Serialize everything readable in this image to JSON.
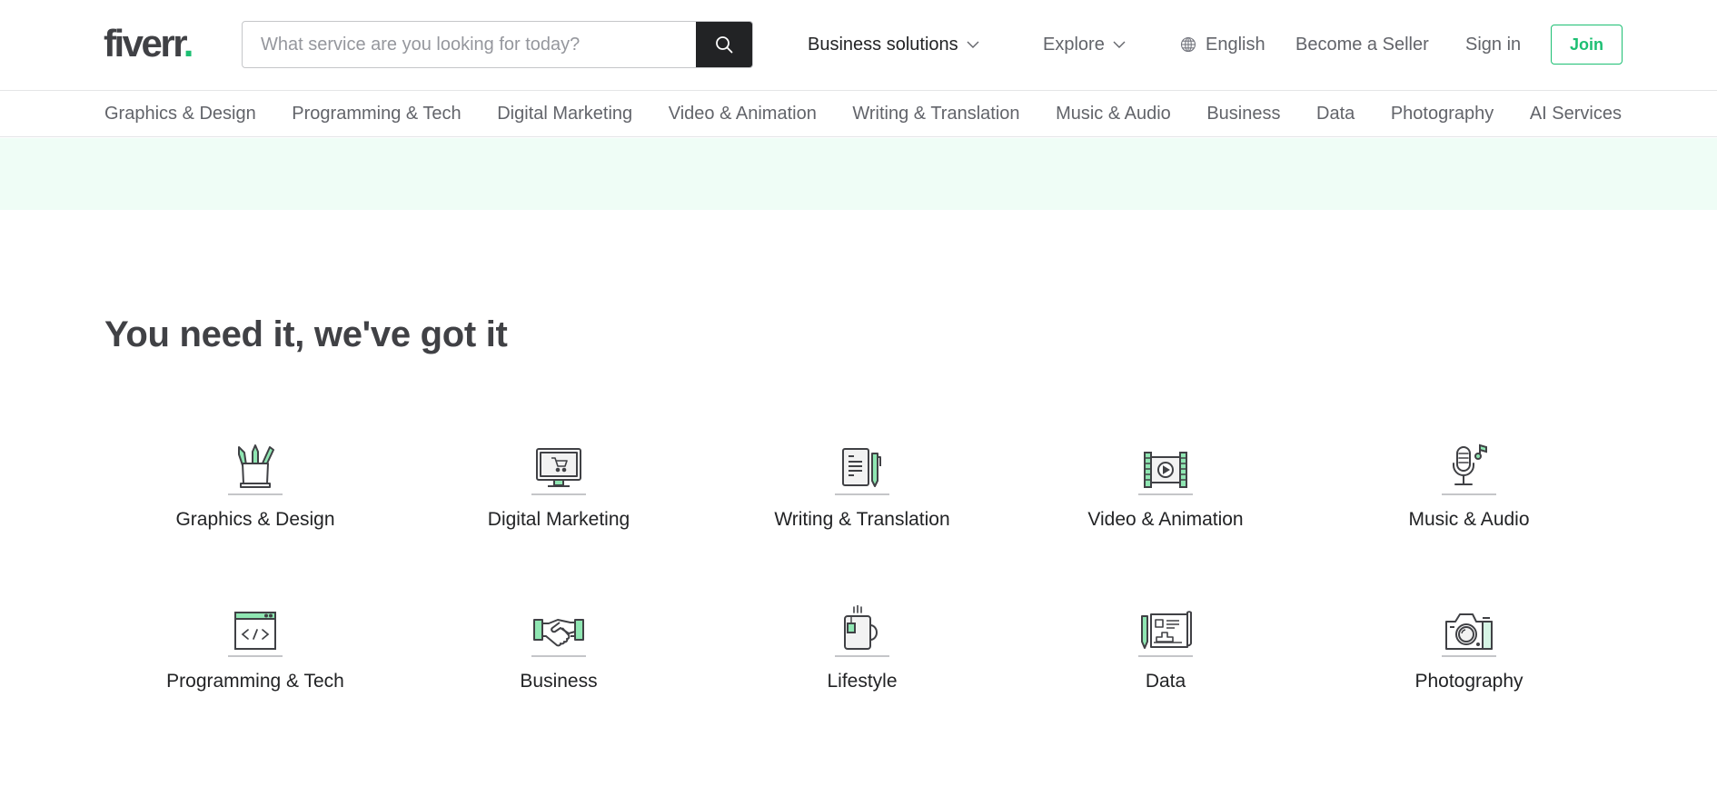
{
  "header": {
    "logo_text": "fiverr",
    "logo_dot": ".",
    "search_placeholder": "What service are you looking for today?",
    "search_value": "",
    "nav": {
      "business_solutions": "Business solutions",
      "explore": "Explore",
      "language": "English",
      "become_seller": "Become a Seller",
      "sign_in": "Sign in",
      "join": "Join"
    }
  },
  "category_bar": [
    "Graphics & Design",
    "Programming & Tech",
    "Digital Marketing",
    "Video & Animation",
    "Writing & Translation",
    "Music & Audio",
    "Business",
    "Data",
    "Photography",
    "AI Services"
  ],
  "main": {
    "heading": "You need it, we've got it",
    "categories": [
      {
        "label": "Graphics & Design",
        "icon": "pencil-cup-icon"
      },
      {
        "label": "Digital Marketing",
        "icon": "monitor-cart-icon"
      },
      {
        "label": "Writing & Translation",
        "icon": "document-pen-icon"
      },
      {
        "label": "Video & Animation",
        "icon": "film-play-icon"
      },
      {
        "label": "Music & Audio",
        "icon": "microphone-note-icon"
      },
      {
        "label": "Programming & Tech",
        "icon": "code-window-icon"
      },
      {
        "label": "Business",
        "icon": "handshake-icon"
      },
      {
        "label": "Lifestyle",
        "icon": "tea-mug-icon"
      },
      {
        "label": "Data",
        "icon": "data-chart-icon"
      },
      {
        "label": "Photography",
        "icon": "camera-icon"
      }
    ]
  },
  "colors": {
    "brand_green": "#1dbf73",
    "icon_accent": "#8fe6b2",
    "band_background": "#effdf6",
    "text_dark": "#404145",
    "search_button": "#222325"
  }
}
